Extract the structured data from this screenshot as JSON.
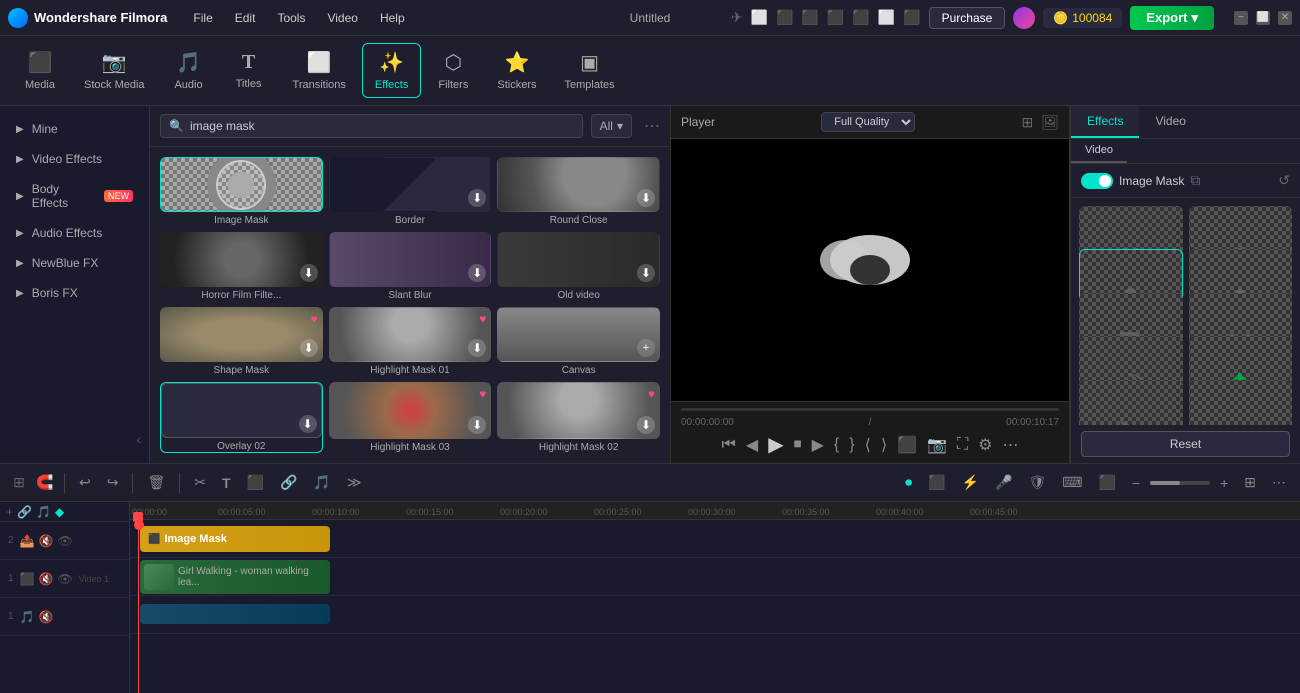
{
  "app": {
    "name": "Wondershare Filmora",
    "title": "Untitled",
    "logo_icon": "🎬"
  },
  "menu": {
    "items": [
      "File",
      "Edit",
      "Tools",
      "Video",
      "Help"
    ]
  },
  "top_right": {
    "purchase_label": "Purchase",
    "coins": "100084",
    "export_label": "Export"
  },
  "toolbar": {
    "items": [
      {
        "id": "media",
        "label": "Media",
        "icon": "⬛"
      },
      {
        "id": "stock-media",
        "label": "Stock Media",
        "icon": "🎞"
      },
      {
        "id": "audio",
        "label": "Audio",
        "icon": "🎵"
      },
      {
        "id": "titles",
        "label": "Titles",
        "icon": "T"
      },
      {
        "id": "transitions",
        "label": "Transitions",
        "icon": "⬜"
      },
      {
        "id": "effects",
        "label": "Effects",
        "icon": "✨"
      },
      {
        "id": "filters",
        "label": "Filters",
        "icon": "⬡"
      },
      {
        "id": "stickers",
        "label": "Stickers",
        "icon": "🌟"
      },
      {
        "id": "templates",
        "label": "Templates",
        "icon": "▣"
      }
    ],
    "active": "effects"
  },
  "sidebar": {
    "items": [
      {
        "label": "Mine"
      },
      {
        "label": "Video Effects"
      },
      {
        "label": "Body Effects",
        "badge": "NEW"
      },
      {
        "label": "Audio Effects"
      },
      {
        "label": "NewBlue FX"
      },
      {
        "label": "Boris FX"
      }
    ]
  },
  "search": {
    "placeholder": "image mask",
    "value": "image mask",
    "filter_label": "All"
  },
  "effects": {
    "grid": [
      {
        "id": "image-mask",
        "label": "Image Mask",
        "selected": true,
        "thumb_class": "thumb-image-mask"
      },
      {
        "id": "border",
        "label": "Border",
        "thumb_class": "thumb-border"
      },
      {
        "id": "round-close",
        "label": "Round Close",
        "thumb_class": "thumb-round-close"
      },
      {
        "id": "horror-film",
        "label": "Horror Film Filte...",
        "thumb_class": "thumb-horror"
      },
      {
        "id": "slant-blur",
        "label": "Slant Blur",
        "thumb_class": "thumb-slant"
      },
      {
        "id": "old-video",
        "label": "Old video",
        "thumb_class": "thumb-old-video"
      },
      {
        "id": "shape-mask",
        "label": "Shape Mask",
        "thumb_class": "thumb-shape-mask"
      },
      {
        "id": "highlight-mask-01",
        "label": "Highlight Mask 01",
        "thumb_class": "thumb-highlight"
      },
      {
        "id": "canvas",
        "label": "Canvas",
        "thumb_class": "thumb-canvas"
      },
      {
        "id": "overlay-02",
        "label": "Overlay 02",
        "thumb_class": "thumb-overlay",
        "selected2": true
      },
      {
        "id": "highlight-mask-03",
        "label": "Highlight Mask 03",
        "thumb_class": "thumb-hm03"
      },
      {
        "id": "highlight-mask-02",
        "label": "Highlight Mask 02",
        "thumb_class": "thumb-highlight"
      }
    ]
  },
  "player": {
    "title": "Player",
    "quality": "Full Quality",
    "current_time": "00:00:00:00",
    "total_time": "00:00:10:17"
  },
  "right_panel": {
    "tabs": [
      "Effects",
      "Video"
    ],
    "active_tab": "Effects",
    "active_sub_tab": "Video",
    "image_mask_label": "Image Mask",
    "reset_label": "Reset",
    "masks": [
      {
        "id": "heart",
        "shape": "heart"
      },
      {
        "id": "diamond",
        "shape": "diamond"
      },
      {
        "id": "flower",
        "shape": "flower",
        "selected": true
      },
      {
        "id": "star-flower",
        "shape": "star-flower"
      },
      {
        "id": "b-shape",
        "shape": "b"
      },
      {
        "id": "x-shape",
        "shape": "x"
      },
      {
        "id": "crescent",
        "shape": "crescent"
      },
      {
        "id": "tree",
        "shape": "tree"
      },
      {
        "id": "arrow",
        "shape": "arrow"
      },
      {
        "id": "circle-blob",
        "shape": "circle"
      }
    ]
  },
  "timeline": {
    "zoom_minus": "−",
    "zoom_plus": "+",
    "tracks": [
      {
        "id": "track-2",
        "number": "2",
        "icons": [
          "📤",
          "🔇",
          "👁"
        ]
      },
      {
        "id": "track-1",
        "number": "1",
        "label": "Video 1",
        "icons": [
          "⬛",
          "🔇",
          "👁"
        ]
      }
    ],
    "ruler_marks": [
      "00:00:00",
      "00:00:05:00",
      "00:00:10:00",
      "00:00:15:00",
      "00:00:20:00",
      "00:00:25:00",
      "00:00:30:00",
      "00:00:35:00",
      "00:00:40:00",
      "00:00:45:00"
    ],
    "clips": [
      {
        "id": "image-mask-clip",
        "label": "Image Mask",
        "type": "effect"
      },
      {
        "id": "video-clip",
        "label": "Girl Walking - woman walking lea...",
        "type": "video"
      }
    ]
  },
  "edit_toolbar": {
    "undo_label": "↩",
    "redo_label": "↪",
    "delete_label": "🗑",
    "cut_label": "✂",
    "text_label": "T",
    "more_label": "⋯"
  }
}
